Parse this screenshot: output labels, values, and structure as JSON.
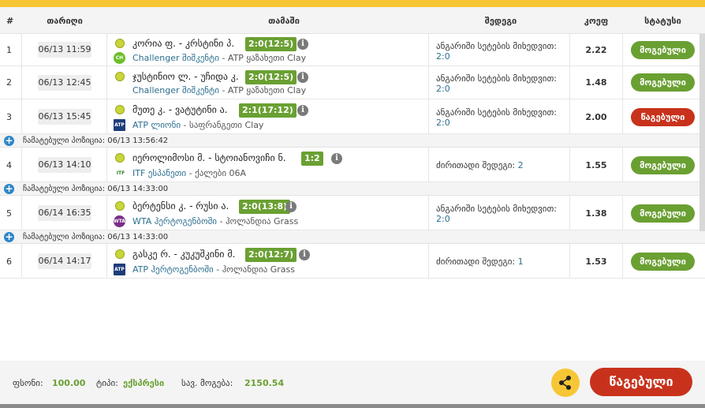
{
  "header": {
    "num": "#",
    "date": "თარიღი",
    "match": "თამაში",
    "market": "შედეგი",
    "coef": "კოეფ",
    "status": "სტატუსი"
  },
  "rows": [
    {
      "num": "1",
      "date": "06/13 11:59",
      "match": "კორია ფ. - კრსტინი პ.",
      "score": "2:0(12:5)",
      "league_a": "Challenger შიშკენტი",
      "league_b": " - ATP ყაზახეთი Clay",
      "market_a": "ანგარიში სეტების მიხედვით:",
      "market_b": "2:0",
      "coef": "2.22",
      "status": "მოგებული"
    },
    {
      "num": "2",
      "date": "06/13 12:45",
      "match": "ჯუსტინიო ლ. - უჩიდა კ.",
      "score": "2:0(12:5)",
      "league_a": "Challenger შიშკენტი",
      "league_b": " - ATP ყაზახეთი Clay",
      "market_a": "ანგარიში სეტების მიხედვით:",
      "market_b": "2:0",
      "coef": "1.48",
      "status": "მოგებული"
    },
    {
      "num": "3",
      "date": "06/13 15:45",
      "match": "მუთე კ. - ვატუტინი ა.",
      "score": "2:1(17:12)",
      "league_a": "ATP ლიონი",
      "league_b": " - საფრანგეთი Clay",
      "market_a": "ანგარიში სეტების მიხედვით:",
      "market_b": "2:0",
      "coef": "2.00",
      "status": "წაგებული"
    },
    {
      "num": "4",
      "date": "06/13 14:10",
      "match": "იეროლიმოსი მ. - სტოიანოვიჩი ნ.",
      "score": "1:2",
      "league_a": "ITF ესპანეთი",
      "league_b": " - ქალები 06A",
      "market_a": "ძირითადი შედეგი: ",
      "market_b": "2",
      "coef": "1.55",
      "status": "მოგებული"
    },
    {
      "num": "5",
      "date": "06/14 16:35",
      "match": "ბერტენსი კ. - რუსი ა.",
      "score": "2:0(13:8)",
      "league_a": "WTA ჰერტოგენბოში",
      "league_b": " - ჰოლანდია Grass",
      "market_a": "ანგარიში სეტების მიხედვით:",
      "market_b": "2:0",
      "coef": "1.38",
      "status": "მოგებული"
    },
    {
      "num": "6",
      "date": "06/14 14:17",
      "match": "გასკე რ. - კუკუშკინი მ.",
      "score": "2:0(12:7)",
      "league_a": "ATP ჰერტოგენბოში",
      "league_b": " - ჰოლანდია Grass",
      "market_a": "ძირითადი შედეგი: ",
      "market_b": "1",
      "coef": "1.53",
      "status": "მოგებული"
    }
  ],
  "separators": [
    "ჩამატებული პოზიცია: 06/13 13:56:42",
    "ჩამატებული პოზიცია: 06/13 14:33:00",
    "ჩამატებული პოზიცია: 06/13 14:33:00"
  ],
  "footer": {
    "stake_label": "ფსონი:",
    "stake_value": "100.00",
    "type_label": "ტიპი:",
    "type_value": "ექსპრესი",
    "total_label": "სავ. მოგება:",
    "total_value": "2150.54",
    "button_label": "წაგებული"
  },
  "logos": {
    "challenger": "CH",
    "atp": "ATP",
    "itf": "ITF",
    "wta": "WTA"
  },
  "colors": {
    "accent": "#f7c634",
    "won": "#6aa032",
    "lost": "#c8321c"
  }
}
